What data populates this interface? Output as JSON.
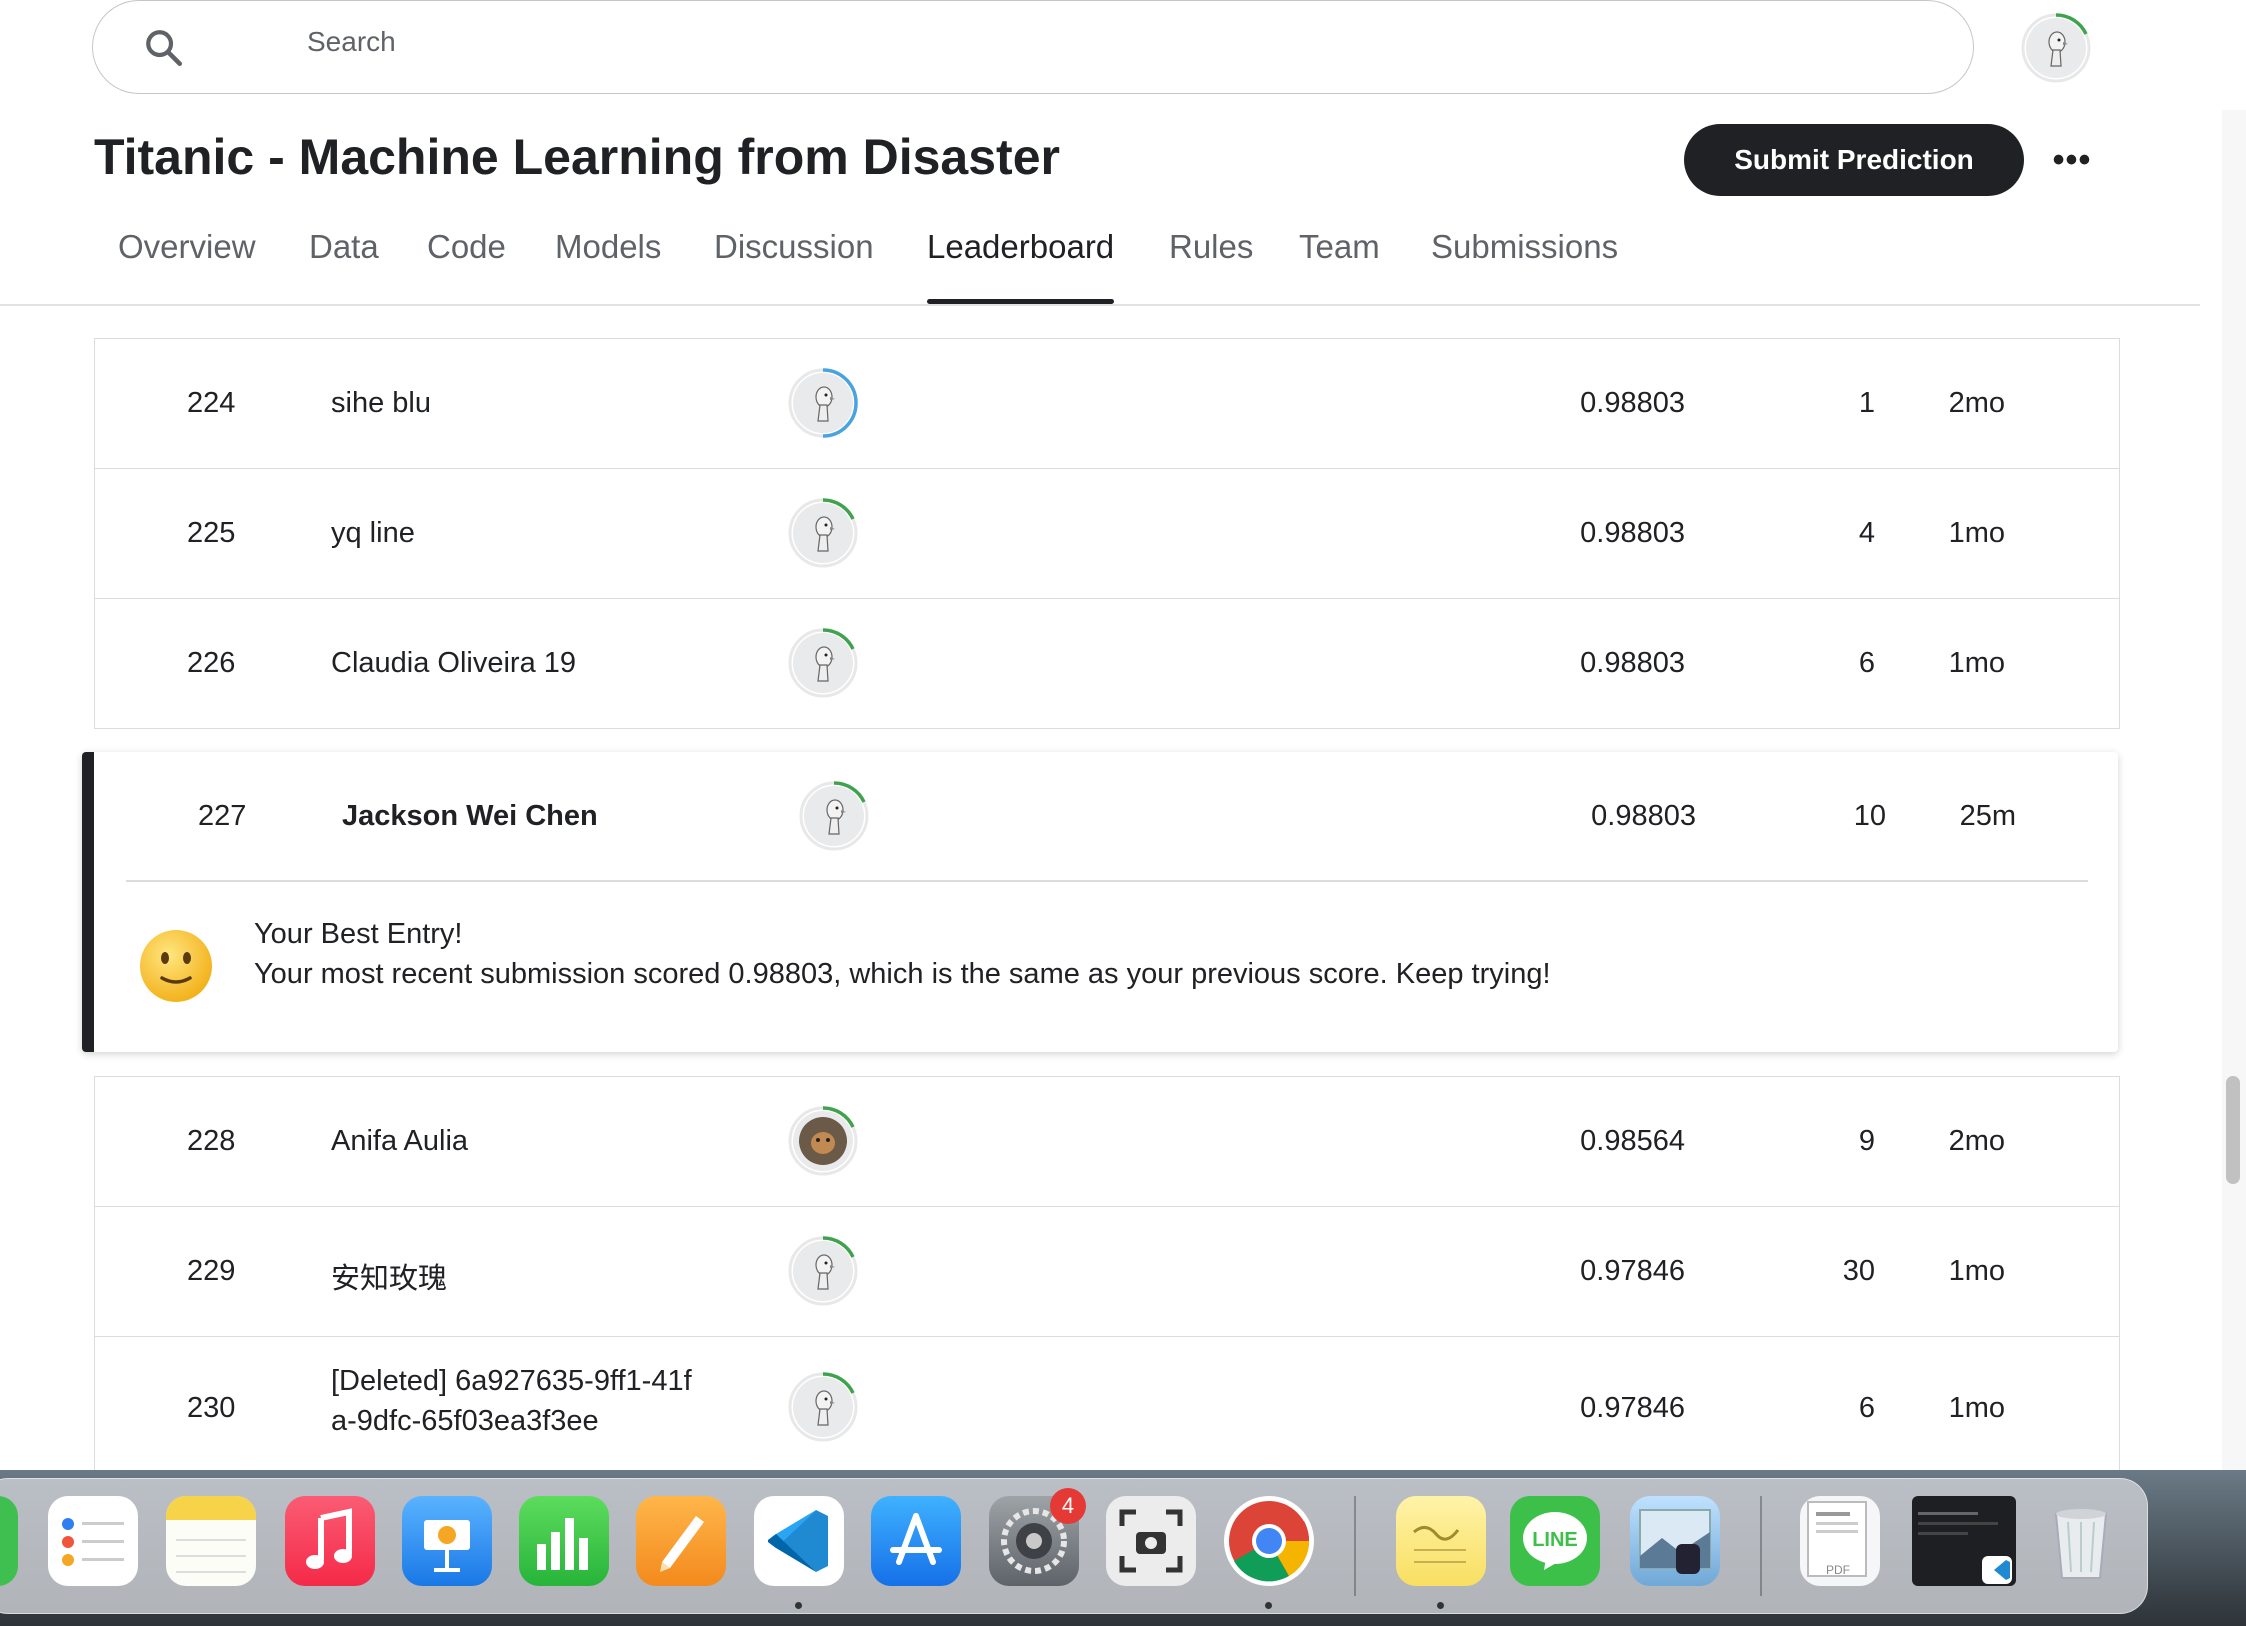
{
  "search": {
    "placeholder": "Search"
  },
  "competition": {
    "title": "Titanic - Machine Learning from Disaster",
    "submit_label": "Submit Prediction",
    "more_label": "•••"
  },
  "tabs": [
    {
      "label": "Overview"
    },
    {
      "label": "Data"
    },
    {
      "label": "Code"
    },
    {
      "label": "Models"
    },
    {
      "label": "Discussion"
    },
    {
      "label": "Leaderboard",
      "active": true
    },
    {
      "label": "Rules"
    },
    {
      "label": "Team"
    },
    {
      "label": "Submissions"
    }
  ],
  "leaderboard": {
    "rows_above": [
      {
        "rank": "224",
        "name": "sihe blu",
        "score": "0.98803",
        "entries": "1",
        "last": "2mo",
        "ring": "#4aa3df"
      },
      {
        "rank": "225",
        "name": "yq line",
        "score": "0.98803",
        "entries": "4",
        "last": "1mo",
        "ring": "#3fa34d"
      },
      {
        "rank": "226",
        "name": "Claudia Oliveira 19",
        "score": "0.98803",
        "entries": "6",
        "last": "1mo",
        "ring": "#3fa34d"
      }
    ],
    "my_row": {
      "rank": "227",
      "name": "Jackson Wei Chen",
      "score": "0.98803",
      "entries": "10",
      "last": "25m",
      "ring": "#3fa34d",
      "message_title": "Your Best Entry!",
      "message_body": "Your most recent submission scored 0.98803, which is the same as your previous score. Keep trying!"
    },
    "rows_below": [
      {
        "rank": "228",
        "name": "Anifa Aulia",
        "score": "0.98564",
        "entries": "9",
        "last": "2mo",
        "ring": "#3fa34d"
      },
      {
        "rank": "229",
        "name": "安知玫瑰",
        "score": "0.97846",
        "entries": "30",
        "last": "1mo",
        "ring": "#3fa34d"
      },
      {
        "rank": "230",
        "name_line1": "[Deleted] 6a927635-9ff1-41f",
        "name_line2": "a-9dfc-65f03ea3f3ee",
        "score": "0.97846",
        "entries": "6",
        "last": "1mo",
        "ring": "#3fa34d"
      }
    ]
  },
  "dock": {
    "apps": [
      "Reminders",
      "Notes",
      "Music",
      "Keynote",
      "Numbers",
      "Pages",
      "Visual Studio Code",
      "App Store",
      "System Settings",
      "Screenshot",
      "Google Chrome",
      "Stickies",
      "LINE",
      "Preview",
      "PDF",
      "Terminal",
      "Trash"
    ],
    "settings_badge": "4",
    "pdf_label": "PDF",
    "line_label": "LINE"
  },
  "colors": {
    "accent": "#202124",
    "progress_blue": "#4aa3df",
    "progress_green": "#3fa34d"
  }
}
